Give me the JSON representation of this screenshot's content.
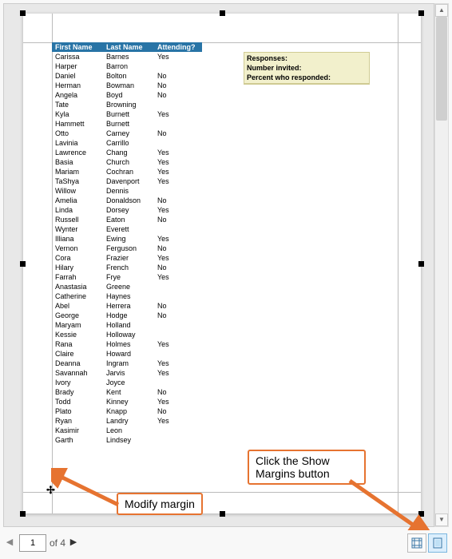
{
  "table": {
    "headers": [
      "First Name",
      "Last Name",
      "Attending?"
    ],
    "rows": [
      [
        "Carissa",
        "Barnes",
        "Yes"
      ],
      [
        "Harper",
        "Barron",
        ""
      ],
      [
        "Daniel",
        "Bolton",
        "No"
      ],
      [
        "Herman",
        "Bowman",
        "No"
      ],
      [
        "Angela",
        "Boyd",
        "No"
      ],
      [
        "Tate",
        "Browning",
        ""
      ],
      [
        "Kyla",
        "Burnett",
        "Yes"
      ],
      [
        "Hammett",
        "Burnett",
        ""
      ],
      [
        "Otto",
        "Carney",
        "No"
      ],
      [
        "Lavinia",
        "Carrillo",
        ""
      ],
      [
        "Lawrence",
        "Chang",
        "Yes"
      ],
      [
        "Basia",
        "Church",
        "Yes"
      ],
      [
        "Mariam",
        "Cochran",
        "Yes"
      ],
      [
        "TaShya",
        "Davenport",
        "Yes"
      ],
      [
        "Willow",
        "Dennis",
        ""
      ],
      [
        "Amelia",
        "Donaldson",
        "No"
      ],
      [
        "Linda",
        "Dorsey",
        "Yes"
      ],
      [
        "Russell",
        "Eaton",
        "No"
      ],
      [
        "Wynter",
        "Everett",
        ""
      ],
      [
        "Illiana",
        "Ewing",
        "Yes"
      ],
      [
        "Vernon",
        "Ferguson",
        "No"
      ],
      [
        "Cora",
        "Frazier",
        "Yes"
      ],
      [
        "Hilary",
        "French",
        "No"
      ],
      [
        "Farrah",
        "Frye",
        "Yes"
      ],
      [
        "Anastasia",
        "Greene",
        ""
      ],
      [
        "Catherine",
        "Haynes",
        ""
      ],
      [
        "Abel",
        "Herrera",
        "No"
      ],
      [
        "George",
        "Hodge",
        "No"
      ],
      [
        "Maryam",
        "Holland",
        ""
      ],
      [
        "Kessie",
        "Holloway",
        ""
      ],
      [
        "Rana",
        "Holmes",
        "Yes"
      ],
      [
        "Claire",
        "Howard",
        ""
      ],
      [
        "Deanna",
        "Ingram",
        "Yes"
      ],
      [
        "Savannah",
        "Jarvis",
        "Yes"
      ],
      [
        "Ivory",
        "Joyce",
        ""
      ],
      [
        "Brady",
        "Kent",
        "No"
      ],
      [
        "Todd",
        "Kinney",
        "Yes"
      ],
      [
        "Plato",
        "Knapp",
        "No"
      ],
      [
        "Ryan",
        "Landry",
        "Yes"
      ],
      [
        "Kasimir",
        "Leon",
        ""
      ],
      [
        "Garth",
        "Lindsey",
        ""
      ]
    ]
  },
  "summary": {
    "responses_label": "Responses:",
    "invited_label": "Number invited:",
    "percent_label": "Percent who responded:"
  },
  "callouts": {
    "modify": "Modify margin",
    "show_margins": "Click the Show Margins button"
  },
  "pager": {
    "current": "1",
    "total_label": "of 4"
  }
}
